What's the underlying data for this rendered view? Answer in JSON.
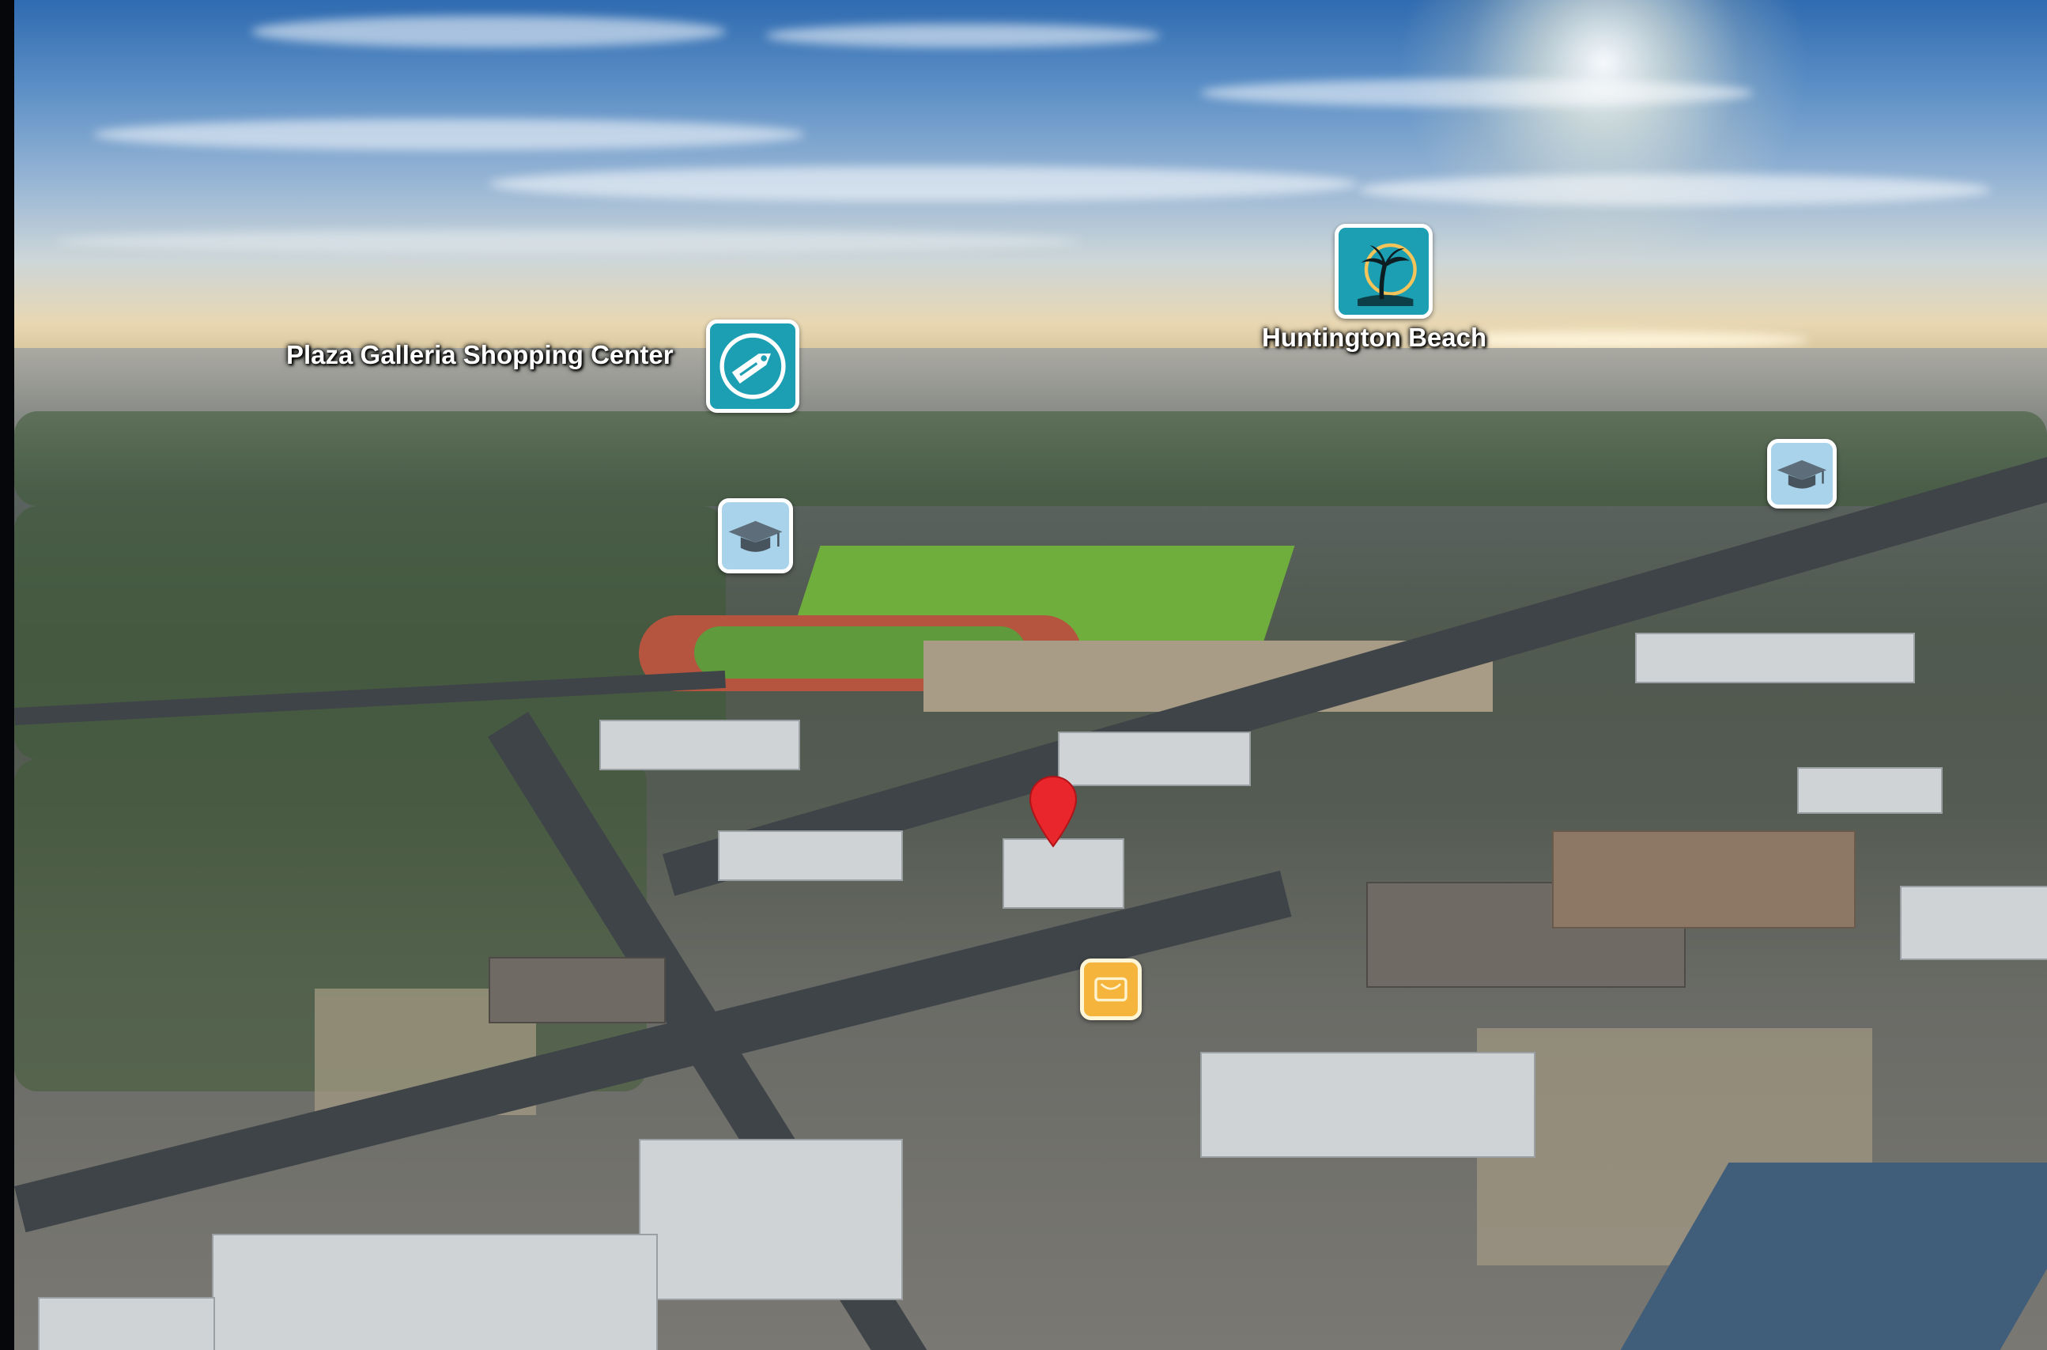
{
  "markers": [
    {
      "icon": "shopping-tag-icon",
      "label": "Plaza Galleria Shopping Center"
    },
    {
      "icon": "palm-tree-beach-icon",
      "label": "Huntington Beach"
    },
    {
      "icon": "graduation-cap-icon",
      "label": ""
    },
    {
      "icon": "graduation-cap-icon",
      "label": ""
    },
    {
      "icon": "restaurant-icon",
      "label": ""
    },
    {
      "icon": "location-pin-icon",
      "label": ""
    }
  ],
  "colors": {
    "marker_teal": "#1d9fb3",
    "marker_light_blue": "#a9d3ea",
    "marker_orange": "#f5b43b",
    "pin_red": "#e8262b",
    "label_text": "#ffffff"
  }
}
